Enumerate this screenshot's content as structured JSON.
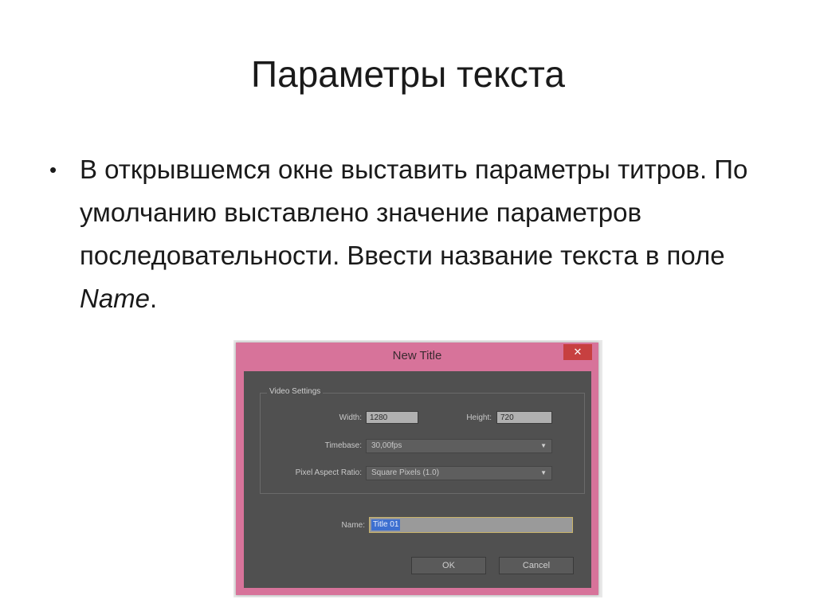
{
  "slide": {
    "title": "Параметры текста",
    "bullet": {
      "marker": "•",
      "text": "В открывшемся окне выставить параметры титров. По умолчанию выставлено значение параметров последовательности. Ввести название текста в поле ",
      "emphasis": "Name",
      "tail": "."
    }
  },
  "dialog": {
    "title": "New Title",
    "close_glyph": "✕",
    "video_settings": {
      "label": "Video Settings",
      "width_label": "Width:",
      "width_value": "1280",
      "height_label": "Height:",
      "height_value": "720",
      "timebase_label": "Timebase:",
      "timebase_value": "30,00fps",
      "par_label": "Pixel Aspect Ratio:",
      "par_value": "Square Pixels (1.0)"
    },
    "name_label": "Name:",
    "name_value": "Title 01",
    "ok_label": "OK",
    "cancel_label": "Cancel"
  },
  "colors": {
    "dialog_frame": "#d7739a",
    "dialog_body": "#505050",
    "selection": "#3d6fd0"
  }
}
